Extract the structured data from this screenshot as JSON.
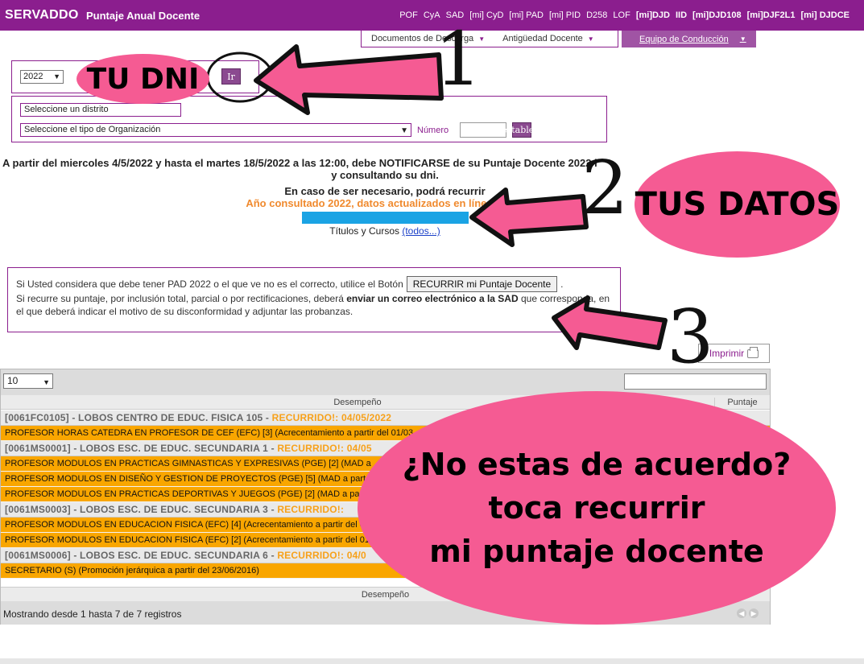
{
  "topbar": {
    "brand": "SERVADDO",
    "subtitle": "Puntaje Anual Docente",
    "nav": [
      {
        "label": "POF",
        "bold": false
      },
      {
        "label": "CyA",
        "bold": false
      },
      {
        "label": "SAD",
        "bold": false
      },
      {
        "label": "[mi] CyD",
        "bold": false
      },
      {
        "label": "[mi] PAD",
        "bold": false
      },
      {
        "label": "[mi] PID",
        "bold": false
      },
      {
        "label": "D258",
        "bold": false
      },
      {
        "label": "LOF",
        "bold": false
      },
      {
        "label": "[mi]DJD",
        "bold": true
      },
      {
        "label": "IID",
        "bold": true
      },
      {
        "label": "[mi]DJD108",
        "bold": true
      },
      {
        "label": "[mi]DJF2L1",
        "bold": true
      },
      {
        "label": "[mi] DJDCE",
        "bold": true
      }
    ]
  },
  "submenu": {
    "documentos": "Documentos de Descarga",
    "antiguedad": "Antigüedad Docente",
    "equipo": "Equipo de Conducción"
  },
  "filters": {
    "year": "2022",
    "ir": "Ir",
    "distrito_placeholder": "Seleccione un distrito",
    "organizacion_placeholder": "Seleccione el tipo de Organización",
    "numero_label": "Número",
    "restablecer": "Restablecer"
  },
  "notice": {
    "line1": "A partir del miercoles 4/5/2022 y hasta el martes 18/5/2022 a las 12:00, debe NOTIFICARSE de su Puntaje Docente 2022 i",
    "line2": "y consultando su dni.",
    "line3": "En caso de ser necesario, podrá recurrir",
    "line4": "Año consultado 2022, datos actualizados en línea por el",
    "titulos": "Títulos y Cursos",
    "todos": "(todos...)"
  },
  "recurrir_box": {
    "line1_before": "Si Usted considera que debe tener PAD 2022 o el que ve no es el correcto, utilice el Botón",
    "button": "RECURRIR mi Puntaje Docente",
    "line1_after": ".",
    "line2_a": "Si recurre su puntaje, por inclusión total, parcial o por rectificaciones, deberá",
    "line2_bold": "enviar un correo electrónico a la SAD",
    "line2_b": "que corresponda, en el que deberá indicar el motivo de su disconformidad y adjuntar las probanzas."
  },
  "imprimir": "Imprimir",
  "table": {
    "length": "10",
    "col_desempeno": "Desempeño",
    "col_puntaje": "Puntaje",
    "groups": [
      {
        "code": "[0061FC0105] - LOBOS CENTRO DE EDUC. FISICA 105 -",
        "status": "RECURRIDO!: 04/05/2022",
        "rows": [
          "PROFESOR HORAS CATEDRA EN PROFESOR DE CEF (EFC) [3] (Acrecentamiento a partir del 01/03"
        ]
      },
      {
        "code": "[0061MS0001] - LOBOS ESC. DE EDUC. SECUNDARIA 1 -",
        "status": "RECURRIDO!: 04/05",
        "rows": [
          "PROFESOR MODULOS EN PRACTICAS GIMNASTICAS Y EXPRESIVAS (PGE) [2] (MAD a",
          "PROFESOR MODULOS EN DISEÑO Y GESTION DE PROYECTOS (PGE) [5] (MAD a part",
          "PROFESOR MODULOS EN PRACTICAS DEPORTIVAS Y JUEGOS (PGE) [2] (MAD a part"
        ]
      },
      {
        "code": "[0061MS0003] - LOBOS ESC. DE EDUC. SECUNDARIA 3 -",
        "status": "RECURRIDO!:",
        "rows": [
          "PROFESOR MODULOS EN EDUCACION FISICA (EFC) [4] (Acrecentamiento a partir del 0",
          "PROFESOR MODULOS EN EDUCACION FISICA (EFC) [2] (Acrecentamiento a partir del 01"
        ]
      },
      {
        "code": "[0061MS0006] - LOBOS ESC. DE EDUC. SECUNDARIA 6 -",
        "status": "RECURRIDO!: 04/0",
        "rows": [
          "SECRETARIO (S) (Promoción jerárquica a partir del 23/06/2016)"
        ]
      }
    ],
    "footer_col": "Desempeño",
    "info": "Mostrando desde 1 hasta 7 de 7 registros"
  },
  "annotations": {
    "dni": "TU DNI",
    "datos": "TUS DATOS",
    "big_line1": "¿No estas de acuerdo?",
    "big_line2": "toca  recurrir",
    "big_line3": "mi puntaje docente",
    "num1": "1",
    "num2": "2",
    "num3": "3"
  },
  "colors": {
    "brand_purple": "#8b1e8e",
    "orange_row": "#f9a600",
    "pink_bubble": "#f55b93",
    "recurrido": "#f7a11a"
  }
}
